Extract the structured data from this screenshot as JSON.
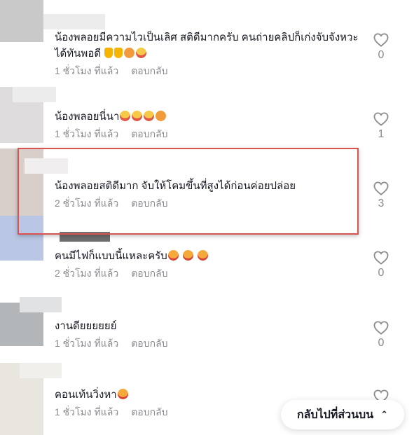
{
  "comments": [
    {
      "text": "น้องพลอยมีความไวเป็นเลิศ สติดีมากครับ คนถ่ายคลิปก็เก่งจับจังหวะได้ทันพอดี",
      "time": "1 ชั่วโมง ที่แล้ว",
      "reply": "ตอบกลับ",
      "likes": "0",
      "emojis": [
        "thumbs-up-emoji",
        "thumbs-up-emoji",
        "kiss-emoji",
        "grin-emoji"
      ]
    },
    {
      "text": "น้องพลอยนี่นา",
      "time": "1 ชั่วโมง ที่แล้ว",
      "reply": "ตอบกลับ",
      "likes": "1",
      "emojis": [
        "grin-emoji",
        "grin-emoji",
        "grin-emoji",
        "kiss-emoji"
      ]
    },
    {
      "text": "น้องพลอยสติดีมาก จับให้โคมขึ้นที่สูงได้ก่อนค่อยปล่อย",
      "time": "2 ชั่วโมง ที่แล้ว",
      "reply": "ตอบกลับ",
      "likes": "3",
      "emojis": []
    },
    {
      "text": "คนมีไฟก็แบบนี้แหละครับ",
      "time": "2 ชั่วโมง ที่แล้ว",
      "reply": "ตอบกลับ",
      "likes": "0",
      "emojis": [
        "laugh-emoji",
        "laugh-emoji",
        "laugh-emoji"
      ]
    },
    {
      "text": "งานดียยยยยย์",
      "time": "1 ชั่วโมง ที่แล้ว",
      "reply": "ตอบกลับ",
      "likes": "0",
      "emojis": []
    },
    {
      "text": "คอนเท้นวิ่งหา",
      "time": "1 ชั่วโมง ที่แล้ว",
      "reply": "ตอบกลับ",
      "likes": "",
      "emojis": [
        "laugh-emoji"
      ]
    }
  ],
  "back_to_top": {
    "label": "กลับไปที่ส่วนบน",
    "icon": "double-chevron-up-icon"
  },
  "colors": {
    "highlight": "#d9534f",
    "secondary_text": "#8a8b91"
  }
}
